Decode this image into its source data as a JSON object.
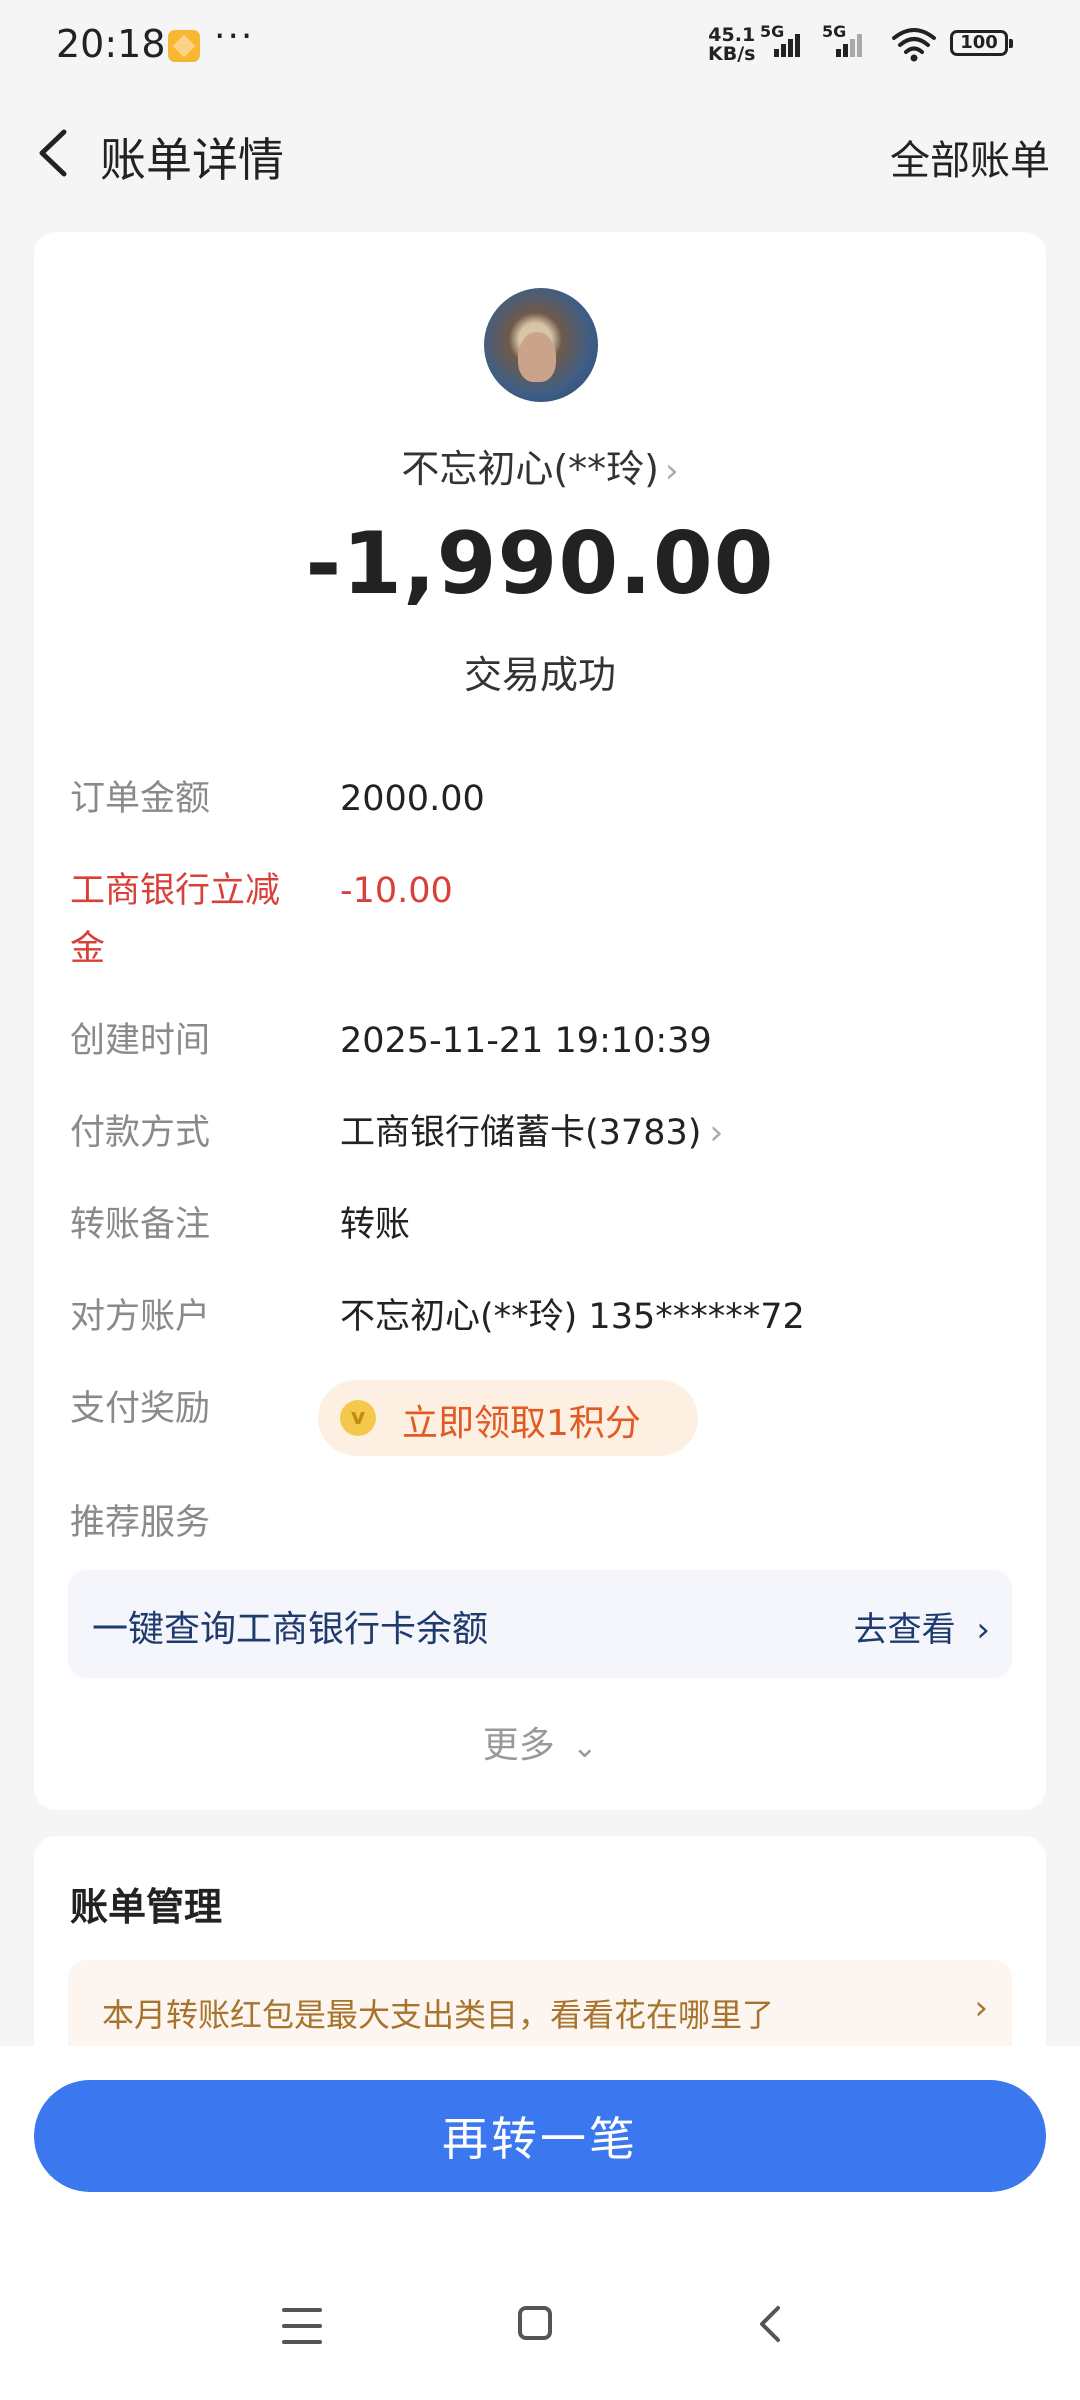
{
  "status_bar": {
    "time": "20:18",
    "dots": "···",
    "net_speed_value": "45.1",
    "net_speed_unit": "KB/s",
    "signal1_label": "5G",
    "signal2_label": "5G",
    "battery": "100"
  },
  "header": {
    "title": "账单详情",
    "all_bills": "全部账单"
  },
  "transaction": {
    "payee": "不忘初心(**玲)",
    "amount": "-1,990.00",
    "status": "交易成功"
  },
  "details": [
    {
      "label": "订单金额",
      "value": "2000.00"
    },
    {
      "label": "工商银行立减金",
      "value": "-10.00"
    },
    {
      "label": "创建时间",
      "value": "2025-11-21 19:10:39"
    },
    {
      "label": "付款方式",
      "value": "工商银行储蓄卡(3783)"
    },
    {
      "label": "转账备注",
      "value": "转账"
    },
    {
      "label": "对方账户",
      "value": "不忘初心(**玲) 135******72"
    },
    {
      "label": "支付奖励",
      "value": "立即领取1积分"
    },
    {
      "label": "推荐服务",
      "value": ""
    }
  ],
  "service": {
    "text": "一键查询工商银行卡余额",
    "action": "去查看"
  },
  "more": "更多",
  "bill_management": {
    "title": "账单管理",
    "tip": "本月转账红包是最大支出类目，看看花在哪里了"
  },
  "action_button": "再转一笔",
  "colors": {
    "accent": "#3b78f0",
    "discount_red": "#d9403a",
    "reward_orange": "#e05a22",
    "service_blue": "#1e3a6e"
  },
  "icons": [
    "back-arrow-icon",
    "chevron-right-icon",
    "chevron-down-icon",
    "coin-icon",
    "menu-icon",
    "home-icon",
    "back-icon",
    "wifi-icon",
    "signal-icon",
    "battery-icon"
  ]
}
